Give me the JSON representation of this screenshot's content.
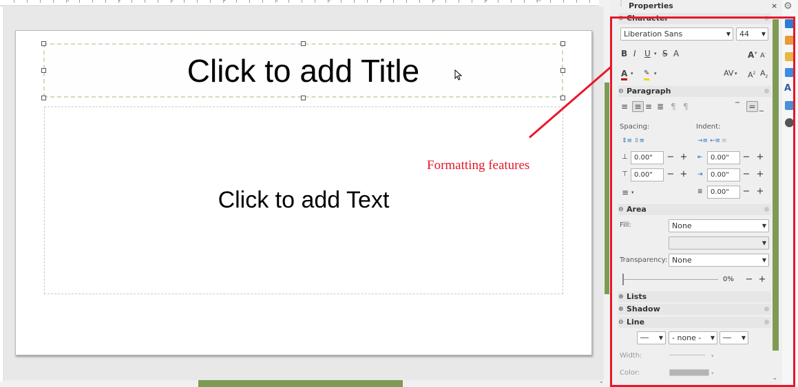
{
  "slide": {
    "title_placeholder": "Click to add Title",
    "text_placeholder": "Click to add Text"
  },
  "annotation": {
    "text": "Formatting features",
    "color": "#e8162a"
  },
  "ruler_numbers": [
    "1",
    "2",
    "3",
    "4",
    "5",
    "6",
    "7",
    "8",
    "9",
    "10"
  ],
  "sidebar": {
    "title": "Properties",
    "close_glyph": "×",
    "character": {
      "header": "Character",
      "font_name": "Liberation Sans",
      "font_size": "44"
    },
    "paragraph": {
      "header": "Paragraph",
      "spacing_label": "Spacing:",
      "indent_label": "Indent:",
      "above_spacing": "0.00\"",
      "below_spacing": "0.00\"",
      "before_indent": "0.00\"",
      "after_indent": "0.00\"",
      "first_line_indent": "0.00\""
    },
    "area": {
      "header": "Area",
      "fill_label": "Fill:",
      "fill_value": "None",
      "fill_secondary": "",
      "transparency_label": "Transparency:",
      "transparency_value": "None",
      "transparency_percent": "0%"
    },
    "lists": {
      "header": "Lists"
    },
    "shadow": {
      "header": "Shadow"
    },
    "line": {
      "header": "Line",
      "style_value": "- none -",
      "width_label": "Width:",
      "color_label": "Color:"
    }
  },
  "colors": {
    "accent_green": "#7d9b54",
    "font_color_red": "#c00000",
    "highlight_yellow": "#f5d400"
  }
}
